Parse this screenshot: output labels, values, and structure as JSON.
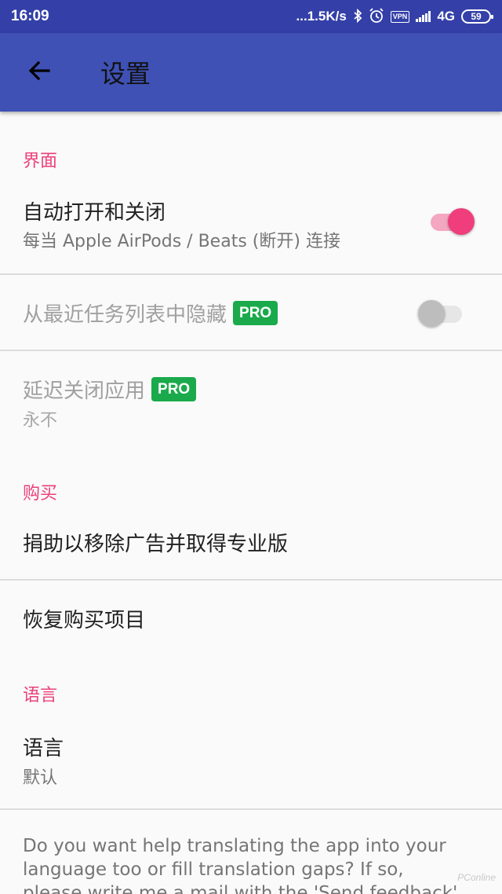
{
  "status_bar": {
    "time": "16:09",
    "network_speed": "...1.5K/s",
    "vpn": "VPN",
    "network_type": "4G",
    "battery": "59"
  },
  "app_bar": {
    "title": "设置",
    "back_icon": "arrow-back-icon"
  },
  "sections": {
    "interface": {
      "header": "界面",
      "auto_open": {
        "title": "自动打开和关闭",
        "summary": "每当 Apple AirPods / Beats (断开) 连接",
        "enabled": true
      },
      "hide_recents": {
        "title": "从最近任务列表中隐藏",
        "badge": "PRO",
        "enabled": false
      },
      "delay_close": {
        "title": "延迟关闭应用",
        "badge": "PRO",
        "summary": "永不"
      }
    },
    "purchase": {
      "header": "购买",
      "donate": {
        "title": "捐助以移除广告并取得专业版"
      },
      "restore": {
        "title": "恢复购买项目"
      }
    },
    "language": {
      "header": "语言",
      "language_pref": {
        "title": "语言",
        "summary": "默认"
      },
      "help_text": "Do you want help translating the app into your language too or fill translation gaps? If so, please write me a mail with the 'Send feedback' button"
    }
  },
  "watermark": "PConline",
  "colors": {
    "status_bar": "#3440a8",
    "app_bar": "#3f51b5",
    "accent": "#ec407a",
    "pro_badge": "#1aaa4b"
  }
}
